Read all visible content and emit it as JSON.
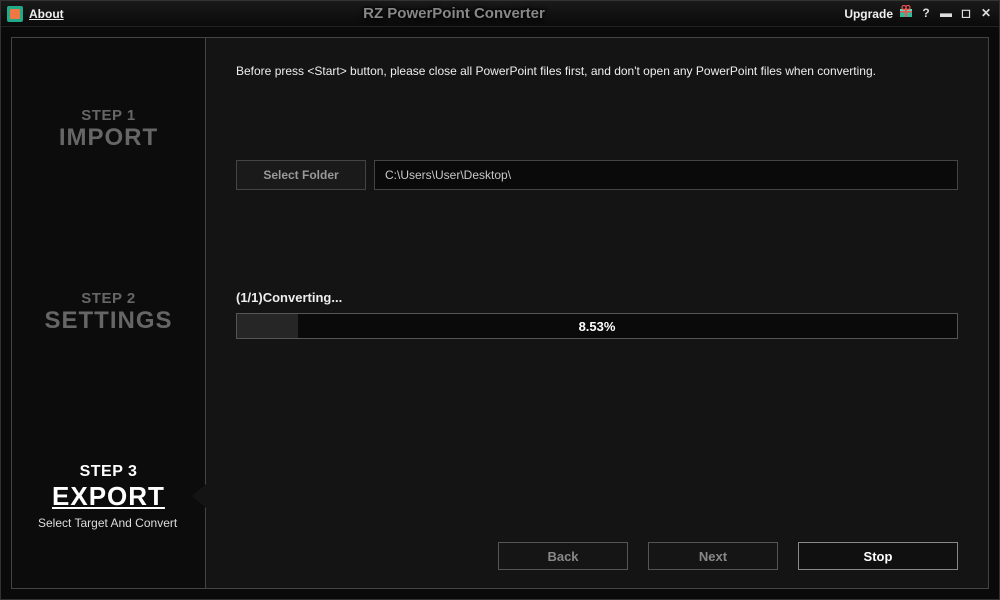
{
  "titlebar": {
    "about": "About",
    "title": "RZ PowerPoint Converter",
    "upgrade": "Upgrade"
  },
  "sidebar": {
    "step1": {
      "num": "STEP 1",
      "title": "IMPORT"
    },
    "step2": {
      "num": "STEP 2",
      "title": "SETTINGS"
    },
    "step3": {
      "num": "STEP 3",
      "title": "EXPORT",
      "sub": "Select Target And Convert"
    }
  },
  "main": {
    "instructions": "Before press <Start> button, please close all PowerPoint files first, and don't open any PowerPoint files when converting.",
    "select_folder_label": "Select Folder",
    "folder_path": "C:\\Users\\User\\Desktop\\",
    "status": "(1/1)Converting...",
    "progress_percent": 8.53,
    "progress_text": "8.53%",
    "back": "Back",
    "next": "Next",
    "stop": "Stop"
  }
}
